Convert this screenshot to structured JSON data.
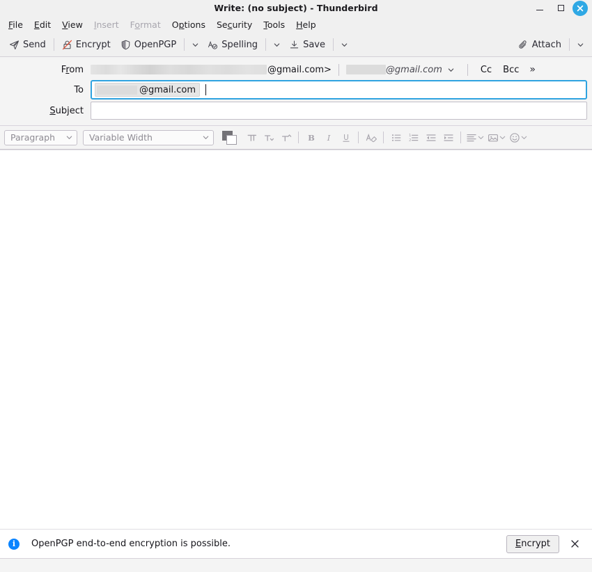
{
  "titlebar": {
    "title": "Write: (no subject) - Thunderbird",
    "minimize_label": "Minimize",
    "maximize_label": "Maximize",
    "close_label": "Close"
  },
  "menubar": {
    "items": [
      {
        "label": "File",
        "accesskey": "F",
        "disabled": false
      },
      {
        "label": "Edit",
        "accesskey": "E",
        "disabled": false
      },
      {
        "label": "View",
        "accesskey": "V",
        "disabled": false
      },
      {
        "label": "Insert",
        "accesskey": "I",
        "disabled": true
      },
      {
        "label": "Format",
        "accesskey": "o",
        "disabled": true
      },
      {
        "label": "Options",
        "accesskey": "O",
        "disabled": false
      },
      {
        "label": "Security",
        "accesskey": "c",
        "disabled": false
      },
      {
        "label": "Tools",
        "accesskey": "T",
        "disabled": false
      },
      {
        "label": "Help",
        "accesskey": "H",
        "disabled": false
      }
    ]
  },
  "toolbar": {
    "send_label": "Send",
    "send_icon": "paper-plane-icon",
    "encrypt_label": "Encrypt",
    "encrypt_icon": "lock-crossed-icon",
    "openpgp_label": "OpenPGP",
    "openpgp_icon": "shield-icon",
    "spelling_label": "Spelling",
    "spelling_icon": "spellcheck-icon",
    "save_label": "Save",
    "save_icon": "save-download-icon",
    "attach_label": "Attach",
    "attach_icon": "paperclip-icon",
    "caret_icon": "chevron-down-icon"
  },
  "headers": {
    "from": {
      "label": "From",
      "accesskey": "r",
      "address_suffix": "@gmail.com>",
      "address_redacted": true,
      "identity_suffix": "@gmail.com",
      "identity_redacted": true,
      "caret_icon": "chevron-down-icon"
    },
    "cc_label": "Cc",
    "bcc_label": "Bcc",
    "more_icon": "chevron-double-right-icon",
    "more_label": "»",
    "to": {
      "label": "To",
      "pill_text": "@gmail.com",
      "pill_redacted": true,
      "focused": true
    },
    "subject": {
      "label": "Subject",
      "accesskey": "S",
      "value": "",
      "placeholder": ""
    }
  },
  "format_toolbar": {
    "paragraph_value": "Paragraph",
    "font_value": "Variable Width",
    "color_swatch_name": "text-color-swatch",
    "color_fg": "#737277",
    "color_bg": "#ffffff",
    "buttons": [
      {
        "name": "font-size-increase-icon",
        "title": "Increase font size"
      },
      {
        "name": "font-size-decrease-icon",
        "title": "Decrease font size"
      },
      {
        "name": "font-size-menu-icon",
        "title": "Font size"
      },
      {
        "name": "bold-icon",
        "title": "Bold",
        "glyph": "B"
      },
      {
        "name": "italic-icon",
        "title": "Italic",
        "glyph": "I"
      },
      {
        "name": "underline-icon",
        "title": "Underline",
        "glyph": "U"
      },
      {
        "name": "remove-formatting-icon",
        "title": "Remove text styling"
      },
      {
        "name": "bullet-list-icon",
        "title": "Unordered list"
      },
      {
        "name": "numbered-list-icon",
        "title": "Ordered list"
      },
      {
        "name": "outdent-icon",
        "title": "Decrease indent"
      },
      {
        "name": "indent-icon",
        "title": "Increase indent"
      },
      {
        "name": "align-icon",
        "title": "Align"
      },
      {
        "name": "insert-image-icon",
        "title": "Insert image"
      },
      {
        "name": "emoji-icon",
        "title": "Insert smiley"
      }
    ]
  },
  "body": {
    "content": ""
  },
  "notification": {
    "icon": "info-icon",
    "message": "OpenPGP end-to-end encryption is possible.",
    "button_label": "Encrypt",
    "button_accesskey": "E",
    "close_icon": "close-icon"
  },
  "colors": {
    "accent_blue": "#2ea3e0",
    "info_blue": "#0a84ff",
    "chrome_bg": "#f0f0f0",
    "header_bg": "#f4f4f4",
    "body_bg": "#ffffff",
    "strike_red": "#e4492d"
  }
}
